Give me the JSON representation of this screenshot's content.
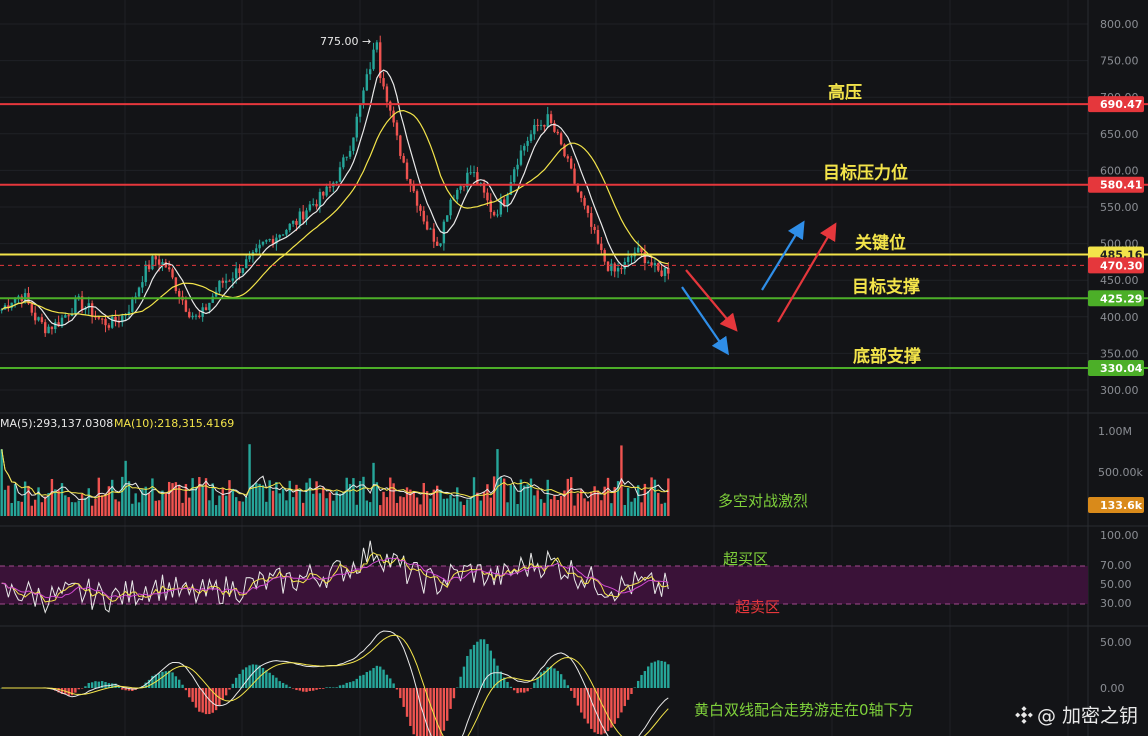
{
  "chart_data": {
    "type": "candlestick",
    "price_axis": {
      "ticks": [
        "800.00",
        "750.00",
        "700.00",
        "650.00",
        "600.00",
        "550.00",
        "500.00",
        "450.00",
        "400.00",
        "350.00",
        "300.00"
      ],
      "tick_values": [
        800,
        750,
        700,
        650,
        600,
        550,
        500,
        450,
        400,
        350,
        300
      ]
    },
    "peak_label": "775.00",
    "levels": [
      {
        "label": "高压",
        "value": 690.47,
        "tag": "690.47",
        "color": "#e5373c"
      },
      {
        "label": "目标压力位",
        "value": 580.41,
        "tag": "580.41",
        "color": "#e5373c"
      },
      {
        "label": "关键位",
        "value": 485.16,
        "tag": "485.16",
        "color": "#f3e44a"
      },
      {
        "label": "目标支撑",
        "value": 425.29,
        "tag": "425.29",
        "color": "#4caf28"
      },
      {
        "label": "底部支撑",
        "value": 330.04,
        "tag": "330.04",
        "color": "#4caf28"
      }
    ],
    "current_price": {
      "value": 470.3,
      "tag": "470.30",
      "color": "#e5373c"
    },
    "close_series_approx": [
      410,
      425,
      430,
      400,
      385,
      390,
      405,
      420,
      410,
      395,
      390,
      400,
      420,
      460,
      480,
      470,
      440,
      410,
      395,
      420,
      445,
      455,
      470,
      480,
      500,
      510,
      520,
      530,
      550,
      560,
      575,
      600,
      640,
      700,
      760,
      720,
      650,
      600,
      560,
      520,
      500,
      560,
      580,
      600,
      570,
      540,
      560,
      610,
      640,
      660,
      670,
      640,
      600,
      560,
      520,
      480,
      460,
      470,
      490,
      480,
      460,
      465
    ],
    "volume": {
      "legend": [
        {
          "label": "MA(5):293,137.0308",
          "color": "#e9e9e9"
        },
        {
          "label": "MA(10):218,315.4169",
          "color": "#f3e44a"
        }
      ],
      "ticks": [
        "1.00M",
        "500.00k"
      ],
      "current_tag": "133.6k",
      "note": "多空对战激烈"
    },
    "rsi": {
      "ticks": [
        "100.00",
        "70.00",
        "50.00",
        "30.00"
      ],
      "overbought_label": "超买区",
      "oversold_label": "超卖区"
    },
    "macd": {
      "ticks": [
        "50.00",
        "0.00"
      ],
      "note": "黄白双线配合走势游走在0轴下方"
    }
  },
  "watermark": "@ 加密之钥"
}
